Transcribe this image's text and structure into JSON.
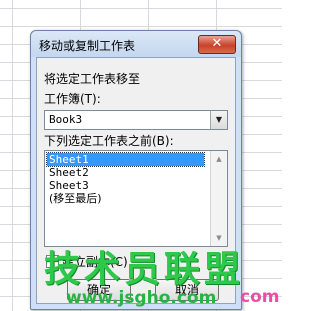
{
  "dialog": {
    "title": "移动或复制工作表",
    "close_glyph": "✕",
    "move_label": "将选定工作表移至",
    "workbook_label": "工作簿(T):",
    "workbook_value": "Book3",
    "before_label": "下列选定工作表之前(B):",
    "sheets": [
      "Sheet1",
      "Sheet2",
      "Sheet3",
      "(移至最后)"
    ],
    "selected_index": 0,
    "copy_checkbox_label": "建立副本(C)",
    "copy_checked": false,
    "ok_button": "确定",
    "cancel_button": "取消"
  },
  "watermark": {
    "brand": "技术员联盟",
    "url": "www.jsgho.com",
    "url_suffix": "com"
  },
  "colors": {
    "watermark_green": "#2ec94a",
    "selection_blue": "#3399ff",
    "close_red": "#c7432a"
  }
}
